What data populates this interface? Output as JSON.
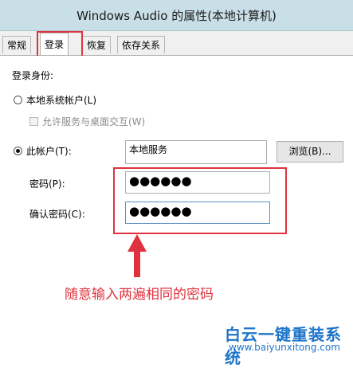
{
  "window": {
    "title": "Windows Audio 的属性(本地计算机)"
  },
  "tabs": [
    {
      "label": "常规"
    },
    {
      "label": "登录"
    },
    {
      "label": "恢复"
    },
    {
      "label": "依存关系"
    }
  ],
  "logon": {
    "section_label": "登录身份:",
    "local_system_label": "本地系统帐户(L)",
    "interact_desktop_label": "允许服务与桌面交互(W)",
    "this_account_label": "此帐户(T):",
    "account_value": "本地服务",
    "browse_label": "浏览(B)...",
    "password_label": "密码(P):",
    "password_value": "●●●●●●",
    "confirm_label": "确认密码(C):",
    "confirm_value": "●●●●●●",
    "selected_option": "this_account"
  },
  "annotation": {
    "text": "随意输入两遍相同的密码"
  },
  "watermark": {
    "title": "白云一键重装系统",
    "url": "www.baiyunxitong.com"
  },
  "colors": {
    "titlebar": "#c9dfe7",
    "annotation_red": "#e0323e",
    "watermark_blue": "#1d74c9"
  }
}
